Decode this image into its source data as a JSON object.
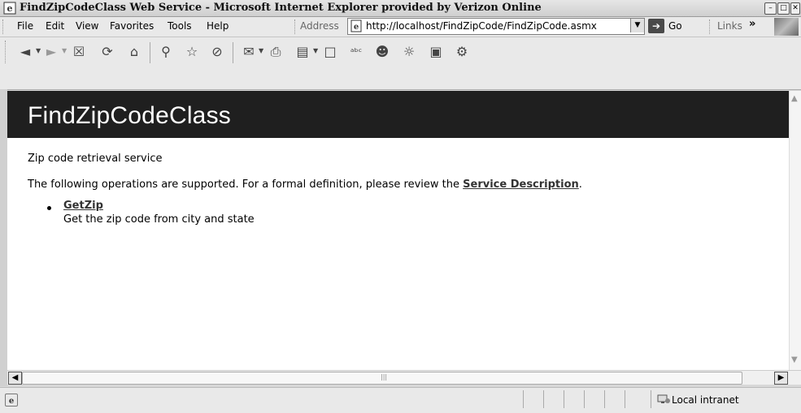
{
  "window": {
    "title": "FindZipCodeClass Web Service - Microsoft Internet Explorer provided by Verizon Online",
    "controls": [
      "minimize",
      "maximize",
      "close"
    ]
  },
  "menubar": {
    "items": [
      "File",
      "Edit",
      "View",
      "Favorites",
      "Tools",
      "Help"
    ],
    "address_label": "Address",
    "url": "http://localhost/FindZipCode/FindZipCode.asmx",
    "go_label": "Go",
    "links_label": "Links",
    "chevron": "»"
  },
  "toolbar": {
    "icons": [
      "back-icon",
      "forward-icon",
      "stop-icon",
      "refresh-icon",
      "home-icon",
      "search-icon",
      "favorites-icon",
      "history-icon",
      "mail-icon",
      "print-icon",
      "edit-icon",
      "discuss-icon",
      "spellcheck-icon",
      "messenger-icon",
      "research-icon",
      "media-icon",
      "tools-icon"
    ]
  },
  "page": {
    "heading": "FindZipCodeClass",
    "description": "Zip code retrieval service",
    "intro_text": "The following operations are supported. For a formal definition, please review the ",
    "service_link": "Service Description",
    "intro_end": ".",
    "operations": [
      {
        "name": "GetZip",
        "description": "Get the zip code from city and state"
      }
    ]
  },
  "statusbar": {
    "zone": "Local intranet"
  },
  "colors": {
    "header_band": "#1f1f1f",
    "header_text": "#ffffff",
    "link": "#333333"
  }
}
